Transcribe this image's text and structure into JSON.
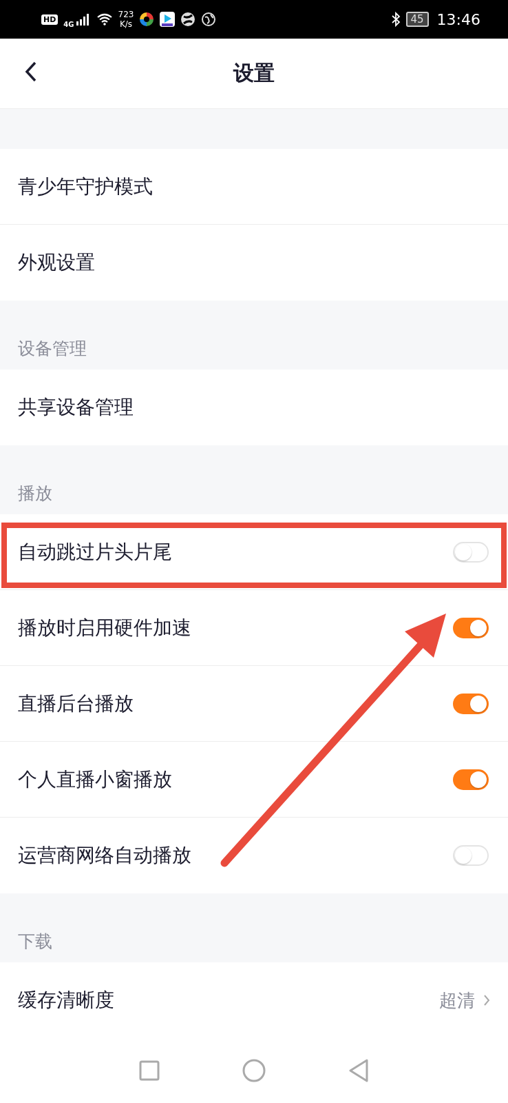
{
  "status_bar": {
    "hd": "HD",
    "network": "4G",
    "speed": "723",
    "speed_unit": "K/s",
    "battery": "45",
    "time": "13:46"
  },
  "header": {
    "title": "设置"
  },
  "sections": [
    {
      "items": [
        {
          "label": "青少年守护模式",
          "kind": "link",
          "highlighted": false
        },
        {
          "label": "外观设置",
          "kind": "link",
          "highlighted": false
        }
      ]
    },
    {
      "title": "设备管理",
      "items": [
        {
          "label": "共享设备管理",
          "kind": "link",
          "highlighted": false
        }
      ]
    },
    {
      "title": "播放",
      "items": [
        {
          "label": "自动跳过片头片尾",
          "kind": "toggle",
          "on": false,
          "highlighted": true
        },
        {
          "label": "播放时启用硬件加速",
          "kind": "toggle",
          "on": true,
          "highlighted": false
        },
        {
          "label": "直播后台播放",
          "kind": "toggle",
          "on": true,
          "highlighted": false
        },
        {
          "label": "个人直播小窗播放",
          "kind": "toggle",
          "on": true,
          "highlighted": false
        },
        {
          "label": "运营商网络自动播放",
          "kind": "toggle",
          "on": false,
          "highlighted": false
        }
      ]
    },
    {
      "title": "下载",
      "items": [
        {
          "label": "缓存清晰度",
          "kind": "value",
          "value": "超清",
          "highlighted": false
        }
      ]
    }
  ]
}
